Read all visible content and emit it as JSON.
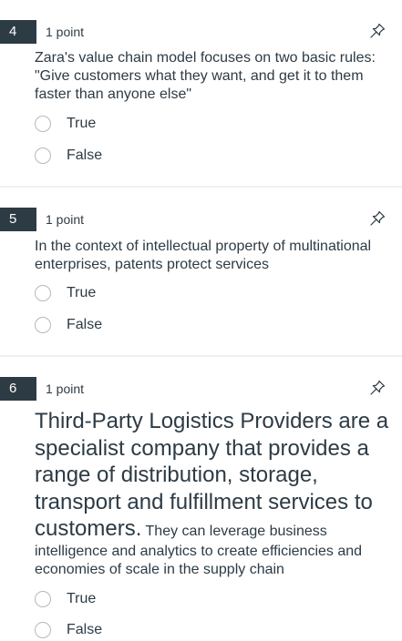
{
  "questions": [
    {
      "number": "4",
      "points": "1 point",
      "text": "Zara's value chain model focuses on two basic rules: \"Give customers what they want, and get it to them faster than anyone else\"",
      "answers": [
        "True",
        "False"
      ]
    },
    {
      "number": "5",
      "points": "1 point",
      "text": "In the context of intellectual property of multinational enterprises, patents protect services",
      "answers": [
        "True",
        "False"
      ]
    },
    {
      "number": "6",
      "points": "1 point",
      "text_large": "Third-Party Logistics Providers are a specialist company that provides a range of distribution, storage, transport and fulfillment services to customers.",
      "text_small": "They can leverage business intelligence and analytics to create efficiencies and economies of scale in the supply chain",
      "answers": [
        "True",
        "False"
      ]
    }
  ],
  "icons": {
    "pin": "pin-icon"
  },
  "colors": {
    "badge": "#2d3b45",
    "text": "#2d3b45",
    "radio_border": "#b4b9bd",
    "divider": "#eef0f2"
  }
}
